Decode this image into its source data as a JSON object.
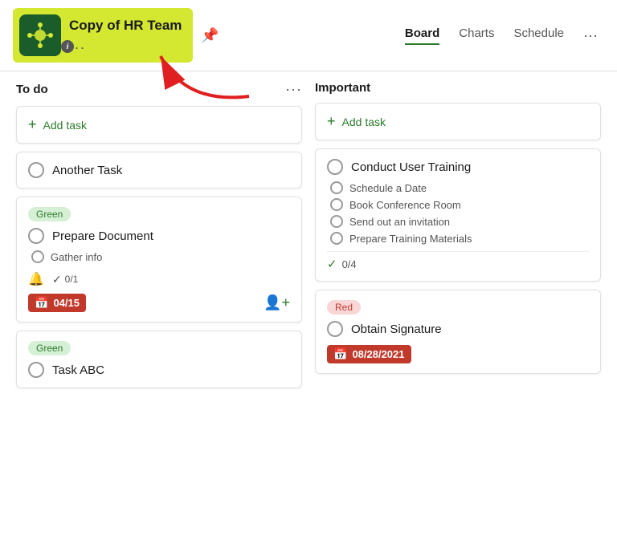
{
  "app": {
    "title": "Copy of HR Team",
    "logo_dots": "...",
    "info_badge": "i",
    "pin_icon": "📌"
  },
  "nav": {
    "tabs": [
      {
        "label": "Board",
        "active": true
      },
      {
        "label": "Charts",
        "active": false
      },
      {
        "label": "Schedule",
        "active": false
      }
    ],
    "more": "···"
  },
  "columns": {
    "todo": {
      "title": "To do",
      "menu": "···",
      "add_task_label": "Add task",
      "cards": [
        {
          "id": "another-task",
          "type": "simple",
          "task": "Another Task"
        },
        {
          "id": "prepare-document",
          "type": "tagged",
          "tag": "Green",
          "tag_type": "green",
          "task": "Prepare Document",
          "sub_tasks": [
            "Gather info"
          ],
          "check_count": "0/1",
          "date": "04/15",
          "has_bell": true
        },
        {
          "id": "task-abc",
          "type": "tagged",
          "tag": "Green",
          "tag_type": "green",
          "task": "Task ABC"
        }
      ]
    },
    "important": {
      "title": "Important",
      "add_task_label": "Add task",
      "cards": [
        {
          "id": "conduct-user-training",
          "type": "subtasks",
          "task": "Conduct User Training",
          "sub_tasks": [
            "Schedule a Date",
            "Book Conference Room",
            "Send out an invitation",
            "Prepare Training Materials"
          ],
          "progress": "0/4"
        },
        {
          "id": "obtain-signature",
          "type": "tagged",
          "tag": "Red",
          "tag_type": "red",
          "task": "Obtain Signature",
          "date": "08/28/2021"
        }
      ]
    }
  }
}
